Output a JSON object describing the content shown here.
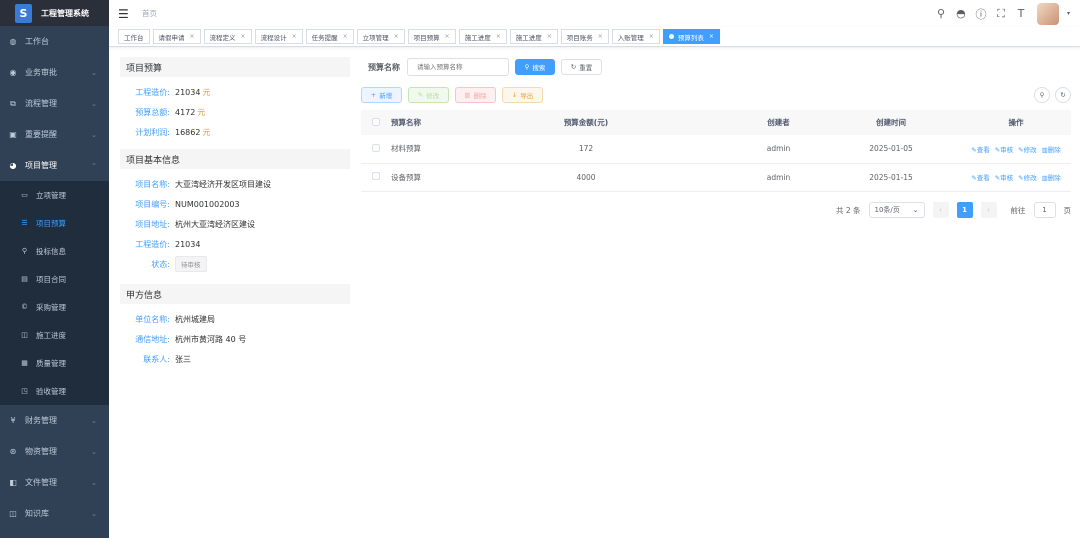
{
  "app": {
    "title": "工程管理系统",
    "logo_glyph": "S"
  },
  "sidebar": {
    "items_top": [
      {
        "label": "工作台",
        "icon": "dashboard-icon",
        "glyph": "◍"
      },
      {
        "label": "业务审批",
        "icon": "approval-icon",
        "glyph": "◉"
      },
      {
        "label": "流程管理",
        "icon": "process-icon",
        "glyph": "⧉"
      },
      {
        "label": "重要提醒",
        "icon": "reminder-icon",
        "glyph": "▣"
      }
    ],
    "project": {
      "label": "项目管理",
      "icon": "project-icon",
      "glyph": "◕"
    },
    "sub_items": [
      {
        "label": "立项管理",
        "glyph": "▭"
      },
      {
        "label": "项目预算",
        "glyph": "☰",
        "active": true
      },
      {
        "label": "投标信息",
        "glyph": "⚲"
      },
      {
        "label": "项目合同",
        "glyph": "▤"
      },
      {
        "label": "采购管理",
        "glyph": "©"
      },
      {
        "label": "施工进度",
        "glyph": "◫"
      },
      {
        "label": "质量管理",
        "glyph": "▦"
      },
      {
        "label": "验收管理",
        "glyph": "◳"
      }
    ],
    "items_bottom": [
      {
        "label": "财务管理",
        "icon": "finance-icon",
        "glyph": "¥"
      },
      {
        "label": "物资管理",
        "icon": "material-icon",
        "glyph": "⊛"
      },
      {
        "label": "文件管理",
        "icon": "file-icon",
        "glyph": "◧"
      },
      {
        "label": "知识库",
        "icon": "knowledge-icon",
        "glyph": "◫"
      }
    ]
  },
  "header": {
    "breadcrumb": "首页"
  },
  "tags": [
    {
      "label": "工作台",
      "closable": false
    },
    {
      "label": "请假申请",
      "closable": true
    },
    {
      "label": "流程定义",
      "closable": true
    },
    {
      "label": "流程设计",
      "closable": true
    },
    {
      "label": "任务提醒",
      "closable": true
    },
    {
      "label": "立项管理",
      "closable": true
    },
    {
      "label": "项目预算",
      "closable": true
    },
    {
      "label": "施工进度",
      "closable": true
    },
    {
      "label": "施工进度",
      "closable": true
    },
    {
      "label": "项目账务",
      "closable": true
    },
    {
      "label": "入账管理",
      "closable": true
    },
    {
      "label": "预算列表",
      "closable": true,
      "active": true
    }
  ],
  "budget_section": {
    "title": "项目预算",
    "rows": [
      {
        "label": "工程造价:",
        "value": "21034",
        "unit": "元"
      },
      {
        "label": "预算总额:",
        "value": "4172",
        "unit": "元"
      },
      {
        "label": "计划利润:",
        "value": "16862",
        "unit": "元"
      }
    ]
  },
  "basic_section": {
    "title": "项目基本信息",
    "rows": [
      {
        "label": "项目名称:",
        "value": "大亚湾经济开发区项目建设"
      },
      {
        "label": "项目编号:",
        "value": "NUM001002003"
      },
      {
        "label": "项目地址:",
        "value": "杭州大亚湾经济区建设"
      },
      {
        "label": "工程造价:",
        "value": "21034"
      }
    ],
    "status_label": "状态:",
    "status_value": "待审核"
  },
  "party_section": {
    "title": "甲方信息",
    "rows": [
      {
        "label": "单位名称:",
        "value": "杭州城建局"
      },
      {
        "label": "通信地址:",
        "value": "杭州市黄河路 40 号"
      },
      {
        "label": "联系人:",
        "value": "张三"
      }
    ]
  },
  "search": {
    "label": "预算名称",
    "placeholder": "请输入预算名称",
    "search_btn": "搜索",
    "reset_btn": "重置"
  },
  "toolbar": {
    "add": "新增",
    "edit": "修改",
    "delete": "删除",
    "export": "导出"
  },
  "table": {
    "headers": [
      "预算名称",
      "预算金额(元)",
      "创建者",
      "创建时间",
      "操作"
    ],
    "rows": [
      {
        "name": "材料预算",
        "amount": "172",
        "creator": "admin",
        "time": "2025-01-05"
      },
      {
        "name": "设备预算",
        "amount": "4000",
        "creator": "admin",
        "time": "2025-01-15"
      }
    ],
    "ops": [
      "查看",
      "审核",
      "修改",
      "删除"
    ]
  },
  "pagination": {
    "total_text": "共 2 条",
    "page_size": "10条/页",
    "current_page": "1",
    "goto_label": "前往",
    "goto_value": "1",
    "page_suffix": "页"
  }
}
